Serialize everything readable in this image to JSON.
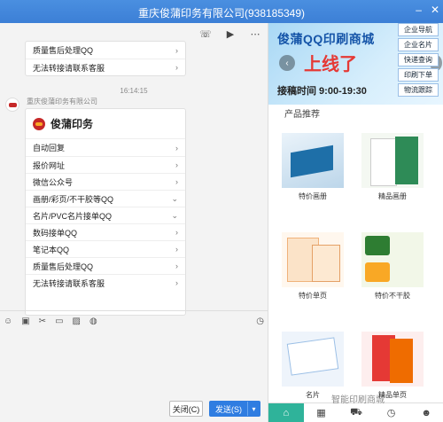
{
  "window": {
    "title": "重庆俊蒲印务有限公司(938185349)"
  },
  "chat": {
    "top_menu": [
      {
        "label": "质量售后处理QQ"
      },
      {
        "label": "无法转接请联系客服"
      }
    ],
    "timestamp": "16:14:15",
    "sender": "重庆俊蒲印务有限公司",
    "card_title": "俊蒲印务",
    "menu": [
      {
        "label": "自动回复"
      },
      {
        "label": "报价网址"
      },
      {
        "label": "微信公众号"
      },
      {
        "label": "画册/彩页/不干胶等QQ"
      },
      {
        "label": "名片/PVC名片接单QQ"
      },
      {
        "label": "数码接单QQ"
      },
      {
        "label": "笔记本QQ"
      },
      {
        "label": "质量售后处理QQ"
      },
      {
        "label": "无法转接请联系客服"
      }
    ],
    "close_label": "关闭(C)",
    "send_label": "发送(S)"
  },
  "side": {
    "banner_title": "俊蒲QQ印刷商城",
    "banner_main": "上线了",
    "banner_hours": "接稿时间 9:00-19:30",
    "quicklinks": [
      "企业导航",
      "企业名片",
      "快递查询",
      "印刷下单",
      "物流跟踪"
    ],
    "section_title": "产品推荐",
    "products": [
      {
        "label": "特价画册"
      },
      {
        "label": "精品画册"
      },
      {
        "label": "特价单页"
      },
      {
        "label": "特价不干胶"
      },
      {
        "label": "名片"
      },
      {
        "label": "精品单页"
      }
    ]
  },
  "watermark": "智能印刷商城"
}
